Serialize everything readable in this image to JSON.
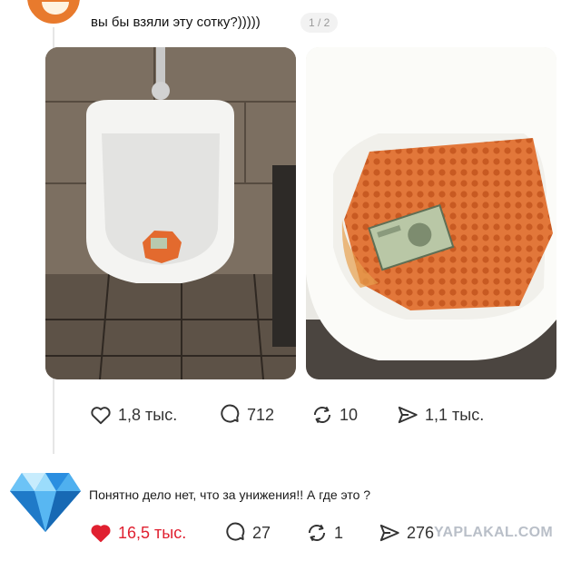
{
  "post": {
    "text": "вы бы взяли эту сотку?)))))",
    "page_counter": "1 / 2",
    "stats": {
      "likes": "1,8 тыс.",
      "comments": "712",
      "reposts": "10",
      "shares": "1,1 тыс."
    }
  },
  "comment": {
    "text": "Понятно дело нет, что за унижения!! А где это ?",
    "stats": {
      "likes": "16,5 тыс.",
      "comments": "27",
      "reposts": "1",
      "shares": "276"
    },
    "liked": true
  },
  "watermark": "YAPLAKAL.COM",
  "colors": {
    "liked": "#e02030",
    "icon": "#333333",
    "avatar": "#e87a2d",
    "gem": "#2a8ee0"
  }
}
